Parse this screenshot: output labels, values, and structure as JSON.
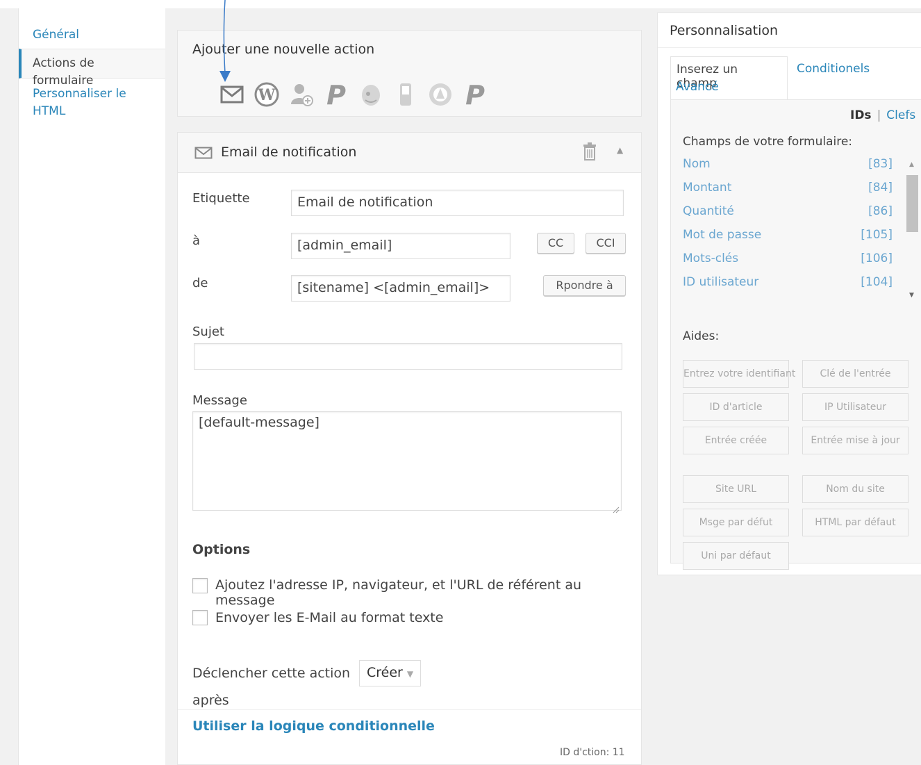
{
  "nav": {
    "items": [
      {
        "label": "Général"
      },
      {
        "label": "Actions de formulaire"
      },
      {
        "label": "Personnaliser le HTML"
      }
    ]
  },
  "add_action": {
    "title": "Ajouter une nouvelle action",
    "icons": [
      "email-icon",
      "wordpress-icon",
      "user-add-icon",
      "paypal-icon",
      "mailchimp-icon",
      "sms-icon",
      "aweber-icon",
      "paypal-pro-icon"
    ]
  },
  "email_action": {
    "title": "Email de notification",
    "label_label": "Etiquette",
    "label_value": "Email de notification",
    "to_label": "à",
    "to_value": "[admin_email]",
    "cc_label": "CC",
    "bcc_label": "CCI",
    "from_label": "de",
    "from_value": "[sitename] <[admin_email]>",
    "reply_label": "Rpondre à",
    "subject_label": "Sujet",
    "subject_value": "",
    "message_label": "Message",
    "message_value": "[default-message]",
    "options_title": "Options",
    "option1": "Ajoutez l'adresse IP, navigateur, et l'URL de référent au message",
    "option2": "Envoyer les E-Mail au format texte",
    "trigger_label": "Déclencher cette action après",
    "trigger_line1": "Déclencher cette action",
    "trigger_line2": "après",
    "trigger_value": "Créer",
    "conditional_link": "Utiliser la logique conditionnelle",
    "action_id": "ID d'ction: 11"
  },
  "customize": {
    "title": "Personnalisation",
    "tab_insert": "Inserez un champ",
    "tab_conditionals": "Conditionels",
    "tab_advanced": "Avancé",
    "ids_label": "IDs",
    "separator": "|",
    "keys_label": "Clefs",
    "fields_title": "Champs de votre formulaire:",
    "fields": [
      {
        "name": "Nom",
        "id": "[83]"
      },
      {
        "name": "Montant",
        "id": "[84]"
      },
      {
        "name": "Quantité",
        "id": "[86]"
      },
      {
        "name": "Mot de passe",
        "id": "[105]"
      },
      {
        "name": "Mots-clés",
        "id": "[106]"
      },
      {
        "name": "ID utilisateur",
        "id": "[104]"
      }
    ],
    "helpers_title": "Aides:",
    "helpers": [
      "Entrez votre identifiant",
      "Clé de l'entrée",
      "ID d'article",
      "IP Utilisateur",
      "Entrée créée",
      "Entrée mise à jour",
      "Site URL",
      "Nom du site",
      "Msge par défut",
      "HTML par défaut",
      "Uni par défaut"
    ]
  },
  "colors": {
    "link": "#2a86b9",
    "field_link": "#6aa6d0",
    "annotation_arrow": "#3a7bc8"
  }
}
